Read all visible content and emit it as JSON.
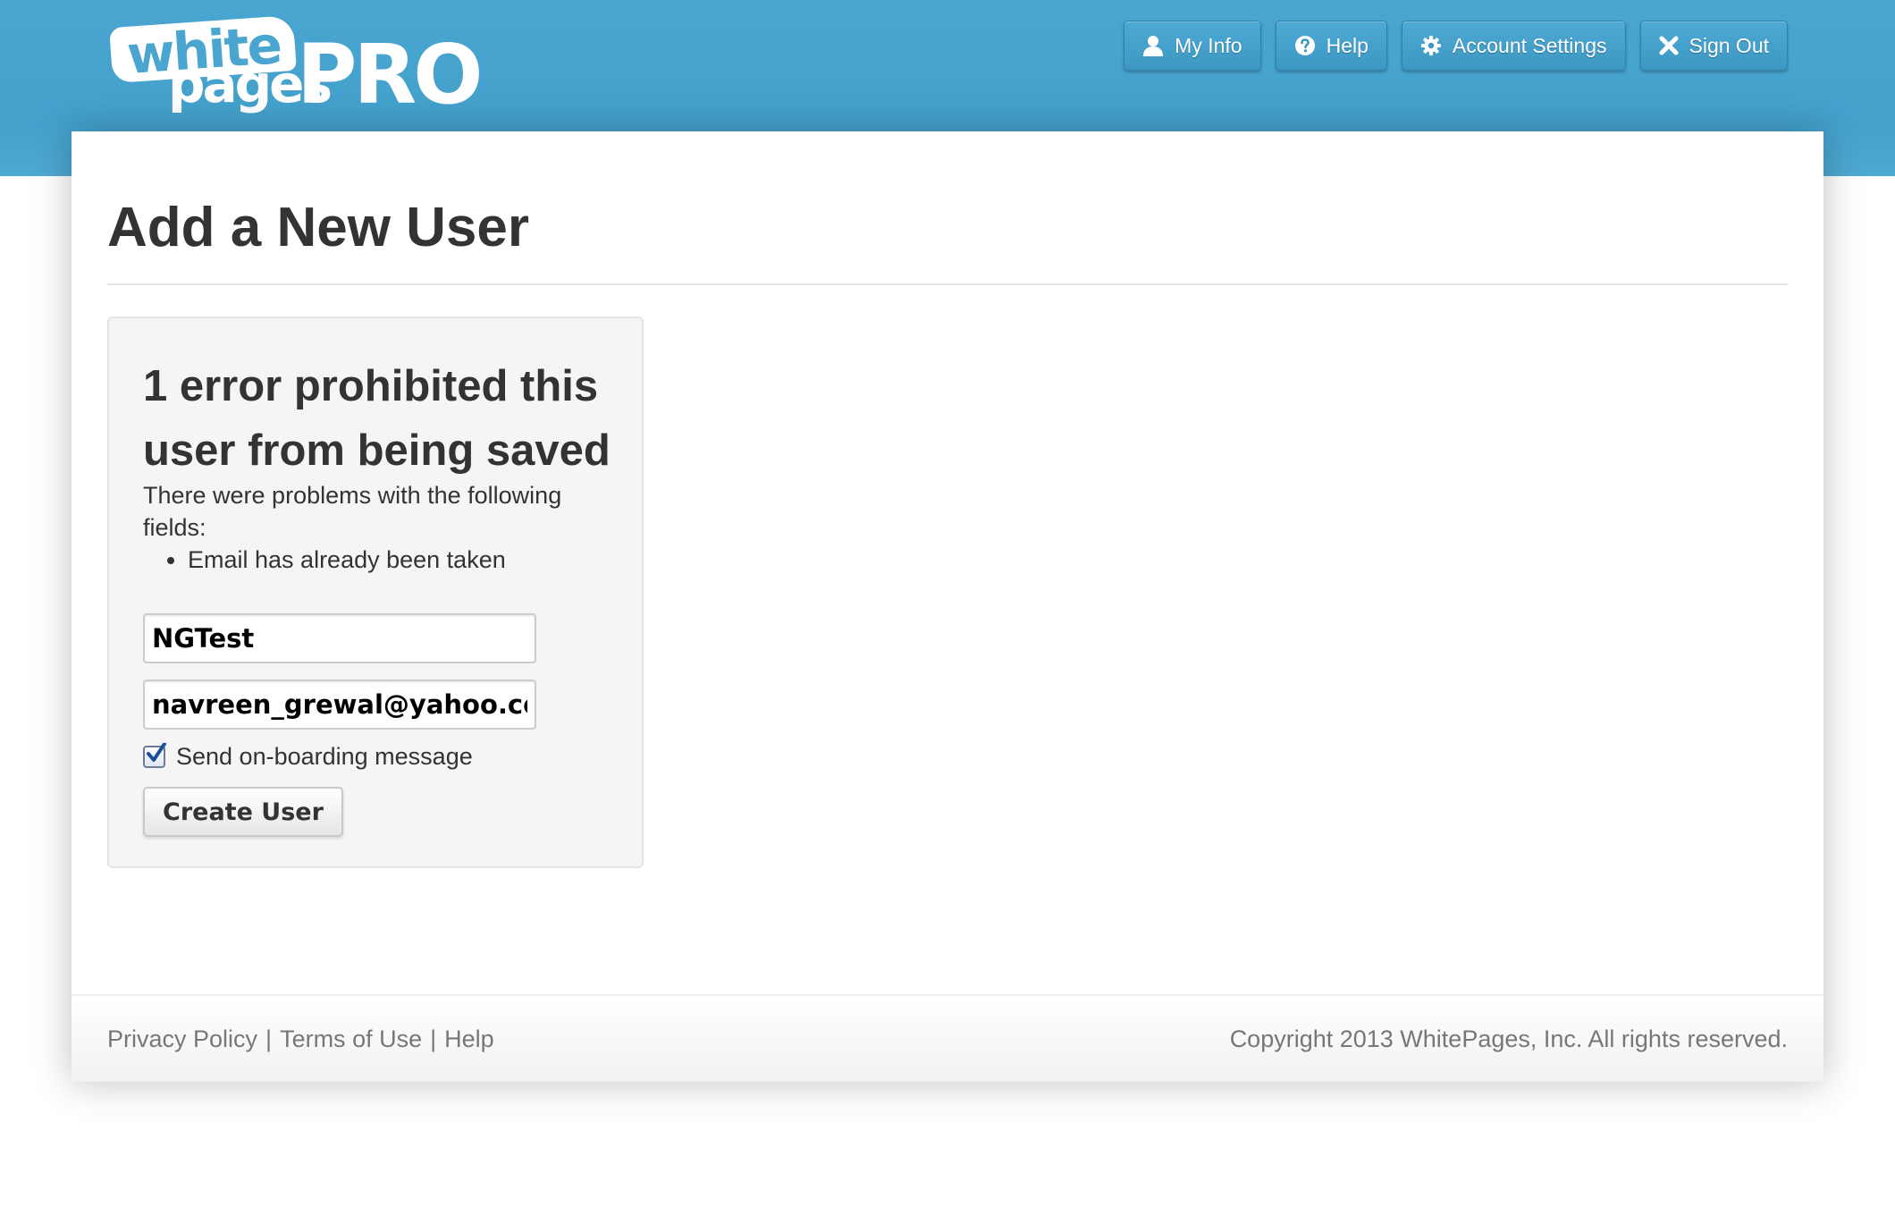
{
  "header": {
    "logo": {
      "word_white": "white",
      "word_pages": "pages",
      "word_pro": "PRO"
    },
    "nav": [
      {
        "label": "My Info",
        "icon": "user-icon"
      },
      {
        "label": "Help",
        "icon": "question-circle-icon"
      },
      {
        "label": "Account Settings",
        "icon": "gear-icon"
      },
      {
        "label": "Sign Out",
        "icon": "close-icon"
      }
    ]
  },
  "page": {
    "title": "Add a New User"
  },
  "error_panel": {
    "heading": "1 error prohibited this user from being saved",
    "intro": "There were problems with the following fields:",
    "errors": [
      "Email has already been taken"
    ]
  },
  "form": {
    "name_value": "NGTest",
    "email_value": "navreen_grewal@yahoo.com",
    "onboarding_checked": true,
    "onboarding_label": "Send on-boarding message",
    "submit_label": "Create User"
  },
  "footer": {
    "links": [
      "Privacy Policy",
      "Terms of Use",
      "Help"
    ],
    "separator": "|",
    "copyright": "Copyright 2013 WhitePages, Inc. All rights reserved."
  },
  "colors": {
    "header_blue": "#4aa6d0",
    "text_dark": "#333333",
    "footer_text": "#777777",
    "panel_bg": "#f5f5f5",
    "checkbox_check": "#1b4f9c"
  }
}
